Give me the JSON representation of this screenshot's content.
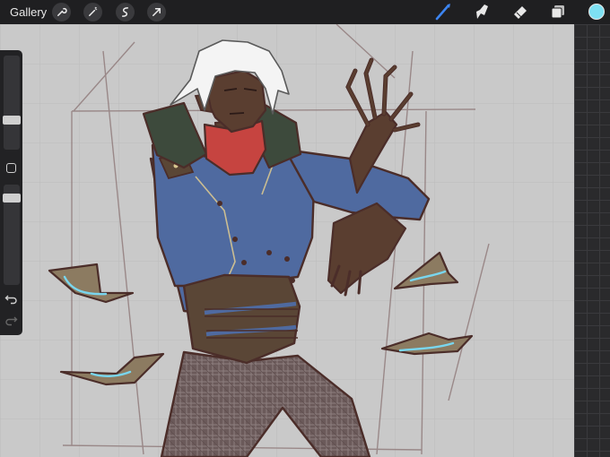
{
  "topbar": {
    "gallery_label": "Gallery",
    "left_tools": [
      "wrench-icon",
      "magic-wand-icon",
      "selection-icon",
      "transform-arrow-icon"
    ],
    "right_tools": [
      "brush-icon",
      "smudge-icon",
      "eraser-icon",
      "layers-icon"
    ],
    "active_tool": "brush-icon",
    "current_color": "#7ee0f2",
    "accent_color": "#3c84f0"
  },
  "sidebar": {
    "size_slider_value": 0.3,
    "opacity_slider_value": 0.9,
    "modify_button": "square-icon",
    "undo": "undo-icon",
    "redo": "redo-icon"
  },
  "canvas": {
    "background": "#c9c9c9",
    "palette": {
      "jacket": "#4f6aa0",
      "skin": "#5a3e30",
      "scarf": "#c64440",
      "hair": "#f4f4f4",
      "collar": "#3d4a3c",
      "paper": "#8c7b61",
      "glow": "#79d6ee",
      "line": "#4b2d29"
    }
  }
}
